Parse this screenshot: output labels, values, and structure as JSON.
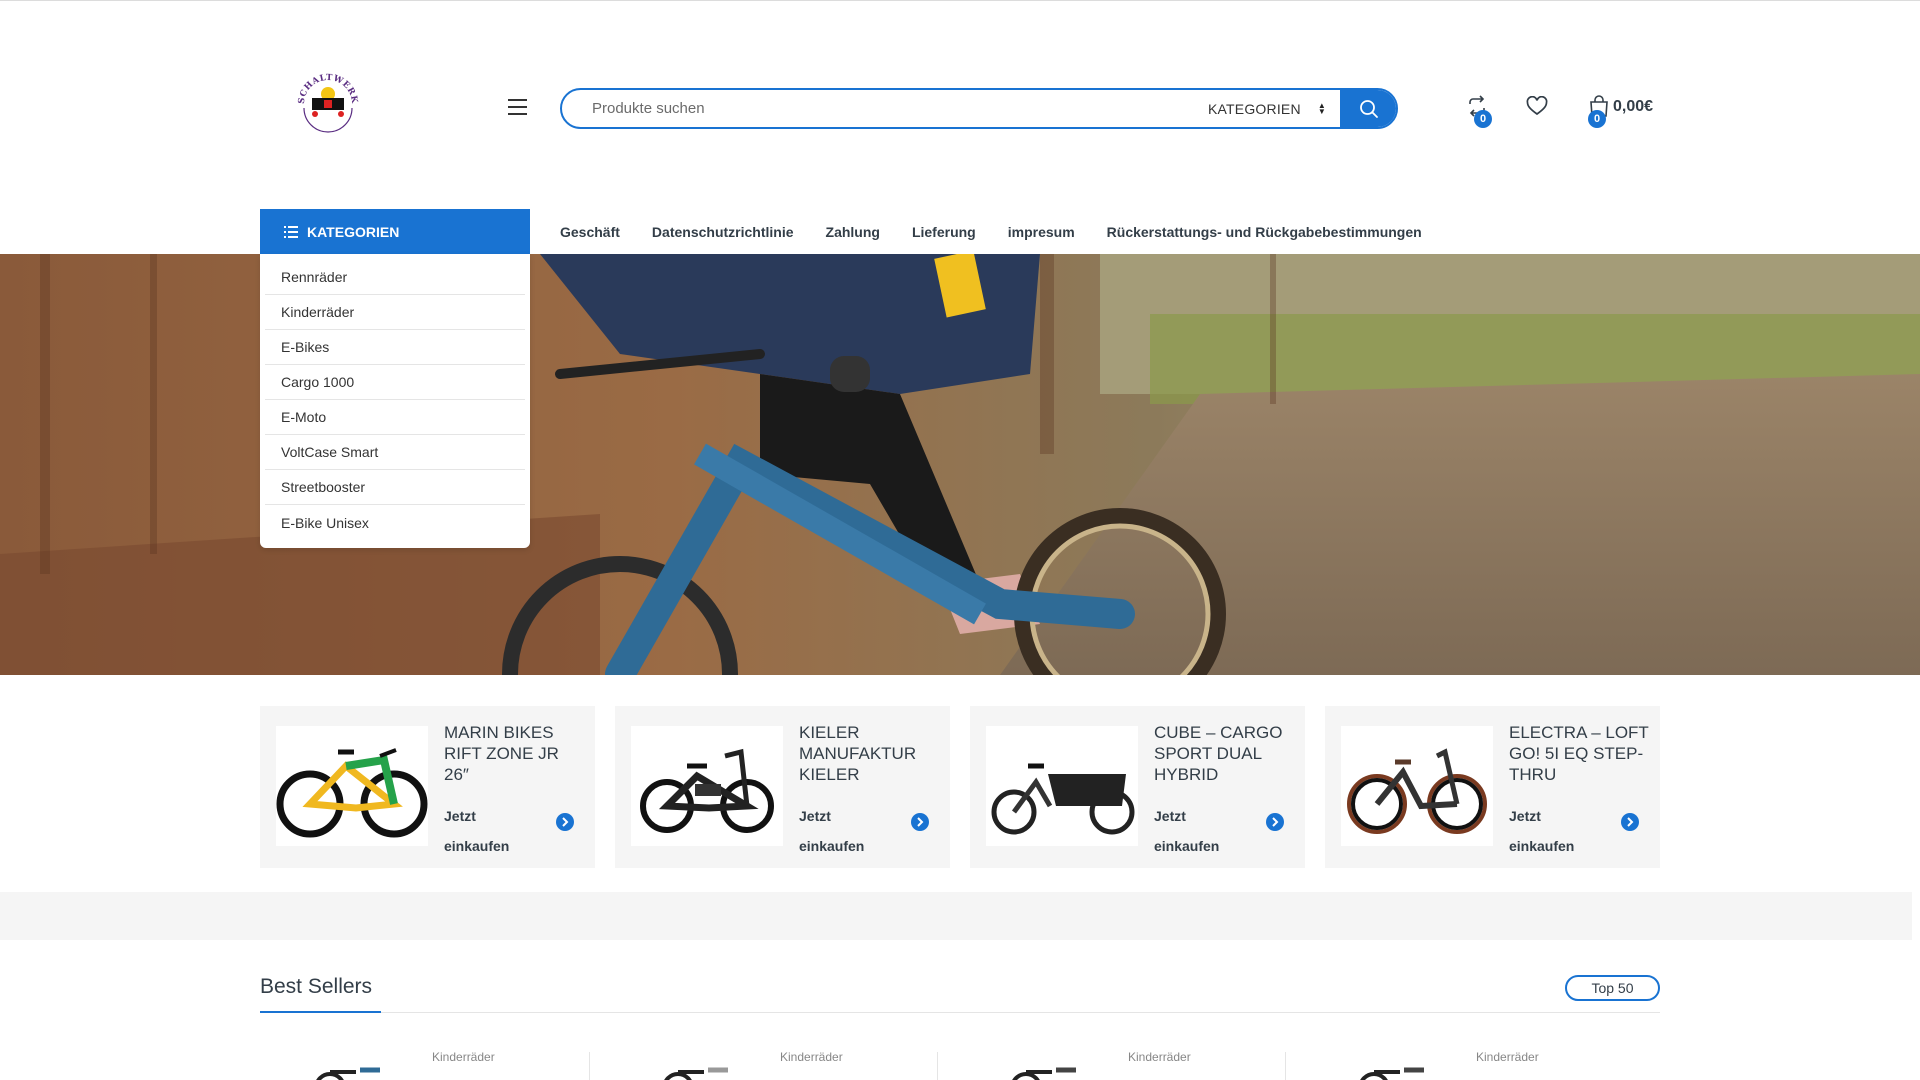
{
  "header": {
    "logo_text": "SCHALTWERKFAHRRAD",
    "search": {
      "placeholder": "Produkte suchen",
      "category_select": "KATEGORIEN"
    },
    "compare_count": "0",
    "wishlist_icon": "heart-icon",
    "cart": {
      "count": "0",
      "total": "0,00€"
    }
  },
  "nav": {
    "categories_label": "KATEGORIEN",
    "links": [
      "Geschäft",
      "Datenschutzrichtlinie",
      "Zahlung",
      "Lieferung",
      "impresum",
      "Rückerstattungs- und Rückgabebestimmungen"
    ]
  },
  "category_menu": [
    "Rennräder",
    "Kinderräder",
    "E-Bikes",
    "Cargo 1000",
    "E-Moto",
    "VoltCase Smart",
    "Streetbooster",
    "E-Bike Unisex"
  ],
  "promos": [
    {
      "title": "MARIN BIKES RIFT ZONE JR 26″",
      "link": "Jetzt einkaufen"
    },
    {
      "title": "KIELER MANUFAKTUR KIELER",
      "link": "Jetzt einkaufen"
    },
    {
      "title": "CUBE – CARGO SPORT DUAL HYBRID",
      "link": "Jetzt einkaufen"
    },
    {
      "title": "ELECTRA – LOFT GO! 5I EQ STEP-THRU",
      "link": "Jetzt einkaufen"
    }
  ],
  "best_sellers": {
    "title": "Best Sellers",
    "tab": "Top 50",
    "products": [
      {
        "category": "Kinderräder"
      },
      {
        "category": "Kinderräder"
      },
      {
        "category": "Kinderräder"
      },
      {
        "category": "Kinderräder"
      }
    ]
  },
  "colors": {
    "accent": "#1973d2",
    "text": "#333e48",
    "panel": "#f5f5f5"
  }
}
